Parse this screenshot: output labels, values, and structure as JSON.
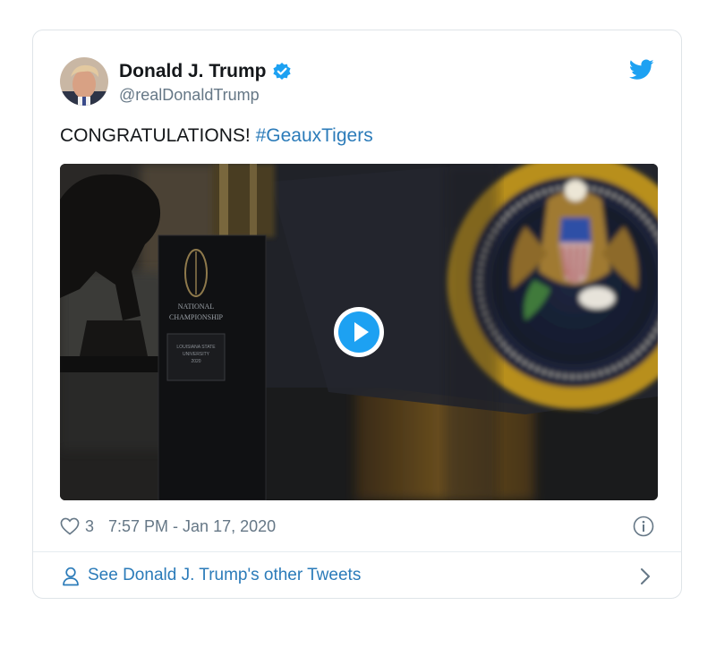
{
  "tweet": {
    "author": {
      "display_name": "Donald J. Trump",
      "handle": "@realDonaldTrump",
      "verified_icon": "verified-badge-icon",
      "avatar_icon": "avatar"
    },
    "text": {
      "main": "CONGRATULATIONS! ",
      "hashtag": "#GeauxTigers"
    },
    "media": {
      "type": "video",
      "play_icon": "play-icon",
      "engraving": {
        "line1": "NATIONAL",
        "line2": "CHAMPIONSHIP",
        "plate1": "LOUISIANA STATE",
        "plate2": "UNIVERSITY",
        "plate3": "2020"
      }
    },
    "meta": {
      "like_count": "3",
      "timestamp": "7:57 PM - Jan 17, 2020"
    },
    "footer": {
      "label": "See Donald J. Trump's other Tweets"
    }
  },
  "colors": {
    "link": "#2b7bb9",
    "twitter_blue": "#1da1f2",
    "text": "#14171a",
    "muted": "#657786"
  }
}
